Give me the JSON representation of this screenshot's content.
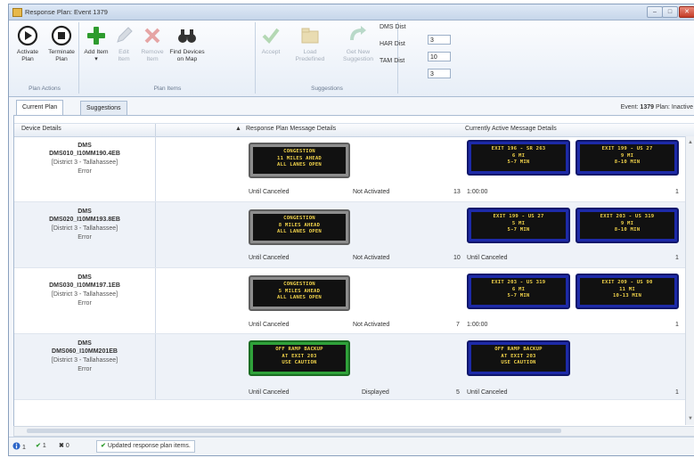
{
  "window": {
    "title": "Response Plan: Event 1379"
  },
  "ribbon": {
    "groups": {
      "plan_actions": "Plan Actions",
      "plan_items": "Plan Items",
      "suggestions": "Suggestions"
    },
    "buttons": {
      "activate": "Activate Plan",
      "terminate": "Terminate Plan",
      "add": "Add Item ▾",
      "edit": "Edit Item",
      "remove": "Remove Item",
      "find_devices": "Find Devices on Map",
      "accept": "Accept",
      "load_predefined": "Load Predefined",
      "get_new_suggestion": "Get New Suggestion"
    },
    "distances": {
      "dms_label": "DMS Dist",
      "dms_value": "3",
      "har_label": "HAR Dist",
      "har_value": "10",
      "tam_label": "TAM Dist",
      "tam_value": "3"
    }
  },
  "tabs": {
    "current_plan": "Current Plan",
    "suggestions": "Suggestions"
  },
  "event_info": {
    "event_label": "Event:",
    "event_value": "1379",
    "plan_label": "Plan:",
    "plan_value": "Inactive"
  },
  "grid": {
    "headers": {
      "device": "Device Details",
      "response": "Response Plan Message Details",
      "active": "Currently Active Message Details"
    },
    "rows": [
      {
        "type": "DMS",
        "name": "DMS010_I10MM190.4EB",
        "district": "[District 3 - Tallahassee]",
        "status": "Error",
        "plan_sign_color": "gray",
        "plan_sign": [
          "CONGESTION",
          "11 MILES AHEAD",
          "ALL LANES OPEN"
        ],
        "duration": "Until Canceled",
        "plan_status": "Not Activated",
        "priority": "13",
        "active_duration": "1:00:00",
        "active_count": "1",
        "active_signs": [
          [
            "EXIT 196 - SR 263",
            "6 MI",
            "5-7 MIN"
          ],
          [
            "EXIT 199 - US 27",
            "9 MI",
            "8-10 MIN"
          ]
        ]
      },
      {
        "type": "DMS",
        "name": "DMS020_I10MM193.8EB",
        "district": "[District 3 - Tallahassee]",
        "status": "Error",
        "plan_sign_color": "gray",
        "plan_sign": [
          "CONGESTION",
          "8 MILES AHEAD",
          "ALL LANES OPEN"
        ],
        "duration": "Until Canceled",
        "plan_status": "Not Activated",
        "priority": "10",
        "active_duration": "Until Canceled",
        "active_count": "1",
        "active_signs": [
          [
            "EXIT 199 - US 27",
            "5 MI",
            "5-7 MIN"
          ],
          [
            "EXIT 203 - US 319",
            "9 MI",
            "8-10 MIN"
          ]
        ]
      },
      {
        "type": "DMS",
        "name": "DMS030_I10MM197.1EB",
        "district": "[District 3 - Tallahassee]",
        "status": "Error",
        "plan_sign_color": "gray",
        "plan_sign": [
          "CONGESTION",
          "5 MILES AHEAD",
          "ALL LANES OPEN"
        ],
        "duration": "Until Canceled",
        "plan_status": "Not Activated",
        "priority": "7",
        "active_duration": "1:00:00",
        "active_count": "1",
        "active_signs": [
          [
            "EXIT 203 - US 319",
            "6 MI",
            "5-7 MIN"
          ],
          [
            "EXIT 209 - US 90",
            "11 MI",
            "10-13 MIN"
          ]
        ]
      },
      {
        "type": "DMS",
        "name": "DMS060_I10MM201EB",
        "district": "[District 3 - Tallahassee]",
        "status": "Error",
        "plan_sign_color": "green",
        "plan_sign": [
          "OFF RAMP BACKUP",
          "AT EXIT 203",
          "USE CAUTION"
        ],
        "duration": "Until Canceled",
        "plan_status": "Displayed",
        "priority": "5",
        "active_duration": "Until Canceled",
        "active_count": "1",
        "active_signs": [
          [
            "OFF RAMP BACKUP",
            "AT EXIT 203",
            "USE CAUTION"
          ]
        ]
      }
    ]
  },
  "status_bar": {
    "info_count": "1",
    "ok_count": "1",
    "error_count": "0",
    "message": "Updated response plan items."
  },
  "colors": {
    "ribbon_bg": "#e7eef7",
    "sign_text": "#f0d24a",
    "sign_active_border": "#1d2aa8",
    "sign_displayed_border": "#2fa23a",
    "sign_inactive_border": "#8d8d8d"
  }
}
